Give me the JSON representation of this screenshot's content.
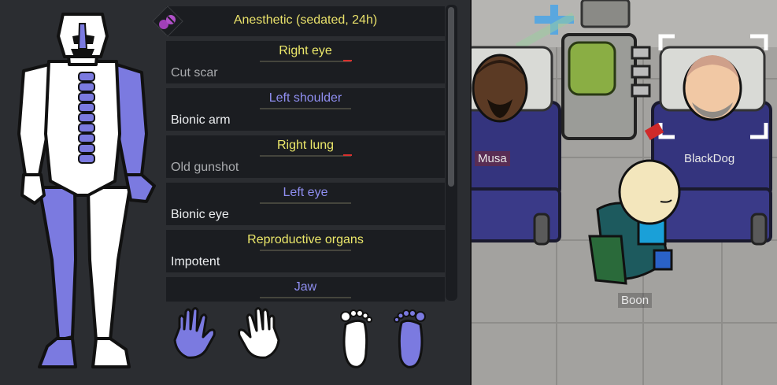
{
  "health_panel": {
    "status_effect": "Anesthetic (sedated, 24h)",
    "parts": [
      {
        "part": "Right eye",
        "condition": "Cut scar"
      },
      {
        "part": "Left shoulder",
        "condition": "Bionic arm"
      },
      {
        "part": "Right lung",
        "condition": "Old gunshot"
      },
      {
        "part": "Left eye",
        "condition": "Bionic eye"
      },
      {
        "part": "Reproductive organs",
        "condition": "Impotent"
      },
      {
        "part": "Jaw",
        "condition": ""
      }
    ]
  },
  "colonists": {
    "musa": "Musa",
    "blackdog": "BlackDog",
    "boon": "Boon"
  },
  "colors": {
    "bionic": "#7a7ae0",
    "label_yellow": "#ece86a",
    "label_blue": "#8f8ef0",
    "bleeding": "#d8302e",
    "bed_blue": "#34347e"
  }
}
